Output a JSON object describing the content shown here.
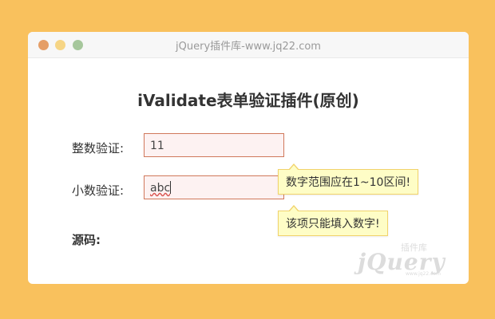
{
  "window": {
    "title": "jQuery插件库-www.jq22.com"
  },
  "page": {
    "title": "iValidate表单验证插件(原创)"
  },
  "form": {
    "integer_label": "整数验证:",
    "integer_value": "11",
    "decimal_label": "小数验证:",
    "decimal_value": "abc",
    "source_label": "源码:"
  },
  "tips": {
    "range_error": "数字范围应在1~10区间!",
    "number_error": "该项只能填入数字!"
  },
  "watermark": {
    "brand": "jQuery",
    "site": "插件库",
    "sub": "www.jq22.com"
  },
  "colors": {
    "background": "#f9c15d",
    "input_border_error": "#d0785b",
    "tip_background": "#fefdc6"
  }
}
